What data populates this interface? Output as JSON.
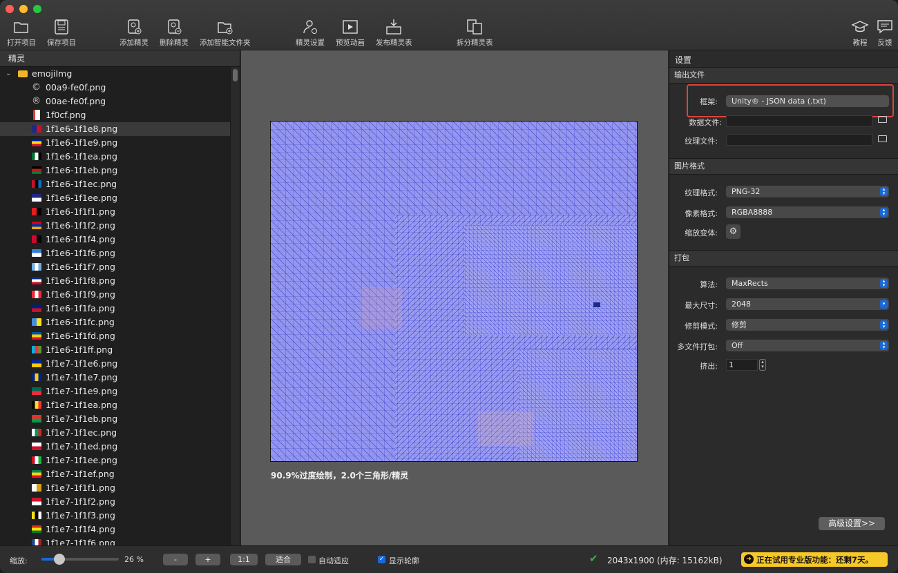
{
  "toolbar": {
    "open": "打开项目",
    "save": "保存项目",
    "add_sprite": "添加精灵",
    "remove_sprite": "删除精灵",
    "add_smart_folder": "添加智能文件夹",
    "sprite_settings": "精灵设置",
    "preview_anim": "预览动画",
    "publish": "发布精灵表",
    "split": "拆分精灵表",
    "tutorial": "教程",
    "feedback": "反馈"
  },
  "left": {
    "title": "精灵",
    "folder": "emojiImg",
    "items": [
      {
        "name": "00a9-fe0f.png",
        "icon": "copyright-symbol",
        "glyph": "©"
      },
      {
        "name": "00ae-fe0f.png",
        "icon": "registered-symbol",
        "glyph": "®"
      },
      {
        "name": "1f0cf.png",
        "icon": "joker-card"
      },
      {
        "name": "1f1e6-1f1e8.png",
        "icon": "flag-ascension",
        "selected": true
      },
      {
        "name": "1f1e6-1f1e9.png",
        "icon": "flag-andorra"
      },
      {
        "name": "1f1e6-1f1ea.png",
        "icon": "flag-uae"
      },
      {
        "name": "1f1e6-1f1eb.png",
        "icon": "flag-afghanistan"
      },
      {
        "name": "1f1e6-1f1ec.png",
        "icon": "flag-antigua"
      },
      {
        "name": "1f1e6-1f1ee.png",
        "icon": "flag-anguilla"
      },
      {
        "name": "1f1e6-1f1f1.png",
        "icon": "flag-albania"
      },
      {
        "name": "1f1e6-1f1f2.png",
        "icon": "flag-armenia"
      },
      {
        "name": "1f1e6-1f1f4.png",
        "icon": "flag-angola"
      },
      {
        "name": "1f1e6-1f1f6.png",
        "icon": "flag-antarctica"
      },
      {
        "name": "1f1e6-1f1f7.png",
        "icon": "flag-argentina"
      },
      {
        "name": "1f1e6-1f1f8.png",
        "icon": "flag-american-samoa"
      },
      {
        "name": "1f1e6-1f1f9.png",
        "icon": "flag-austria"
      },
      {
        "name": "1f1e6-1f1fa.png",
        "icon": "flag-australia"
      },
      {
        "name": "1f1e6-1f1fc.png",
        "icon": "flag-aruba"
      },
      {
        "name": "1f1e6-1f1fd.png",
        "icon": "flag-aland"
      },
      {
        "name": "1f1e6-1f1ff.png",
        "icon": "flag-azerbaijan"
      },
      {
        "name": "1f1e7-1f1e6.png",
        "icon": "flag-bosnia"
      },
      {
        "name": "1f1e7-1f1e7.png",
        "icon": "flag-barbados"
      },
      {
        "name": "1f1e7-1f1e9.png",
        "icon": "flag-bangladesh"
      },
      {
        "name": "1f1e7-1f1ea.png",
        "icon": "flag-belgium"
      },
      {
        "name": "1f1e7-1f1eb.png",
        "icon": "flag-burkina-faso"
      },
      {
        "name": "1f1e7-1f1ec.png",
        "icon": "flag-bulgaria"
      },
      {
        "name": "1f1e7-1f1ed.png",
        "icon": "flag-bahrain"
      },
      {
        "name": "1f1e7-1f1ee.png",
        "icon": "flag-burundi"
      },
      {
        "name": "1f1e7-1f1ef.png",
        "icon": "flag-benin"
      },
      {
        "name": "1f1e7-1f1f1.png",
        "icon": "flag-st-barthelemy"
      },
      {
        "name": "1f1e7-1f1f2.png",
        "icon": "flag-bermuda"
      },
      {
        "name": "1f1e7-1f1f3.png",
        "icon": "flag-brunei"
      },
      {
        "name": "1f1e7-1f1f4.png",
        "icon": "flag-bolivia"
      },
      {
        "name": "1f1e7-1f1f6.png",
        "icon": "flag-caribbean-nl"
      }
    ]
  },
  "canvas": {
    "stats": "90.9%过度绘制，2.0个三角形/精灵"
  },
  "settings": {
    "title": "设置",
    "output_section": "输出文件",
    "framework_label": "框架:",
    "framework_value": "Unity® - JSON data (.txt)",
    "data_file_label": "数据文件:",
    "texture_file_label": "纹理文件:",
    "image_section": "图片格式",
    "texture_format_label": "纹理格式:",
    "texture_format_value": "PNG-32",
    "pixel_format_label": "像素格式:",
    "pixel_format_value": "RGBA8888",
    "scale_variant_label": "缩放变体:",
    "packing_section": "打包",
    "algorithm_label": "算法:",
    "algorithm_value": "MaxRects",
    "max_size_label": "最大尺寸:",
    "max_size_value": "2048",
    "trim_label": "修剪模式:",
    "trim_value": "修剪",
    "multipack_label": "多文件打包:",
    "multipack_value": "Off",
    "extrude_label": "挤出:",
    "extrude_value": "1",
    "advanced": "高级设置>>"
  },
  "status": {
    "zoom_label": "缩放:",
    "zoom_percent": "26 %",
    "zoom_level": 0.26,
    "minus": "-",
    "plus": "+",
    "one_to_one": "1:1",
    "fit": "适合",
    "auto_fit": "自动适应",
    "show_outline": "显示轮廓",
    "size_info": "2043x1900 (内存: 15162kB)",
    "trial": "正在试用专业版功能：还剩7天。"
  },
  "colors": {
    "accent_blue": "#1a68d8",
    "highlight_red": "#e0443a",
    "trial_yellow": "#f7c928",
    "ok_green": "#3bb54a"
  }
}
